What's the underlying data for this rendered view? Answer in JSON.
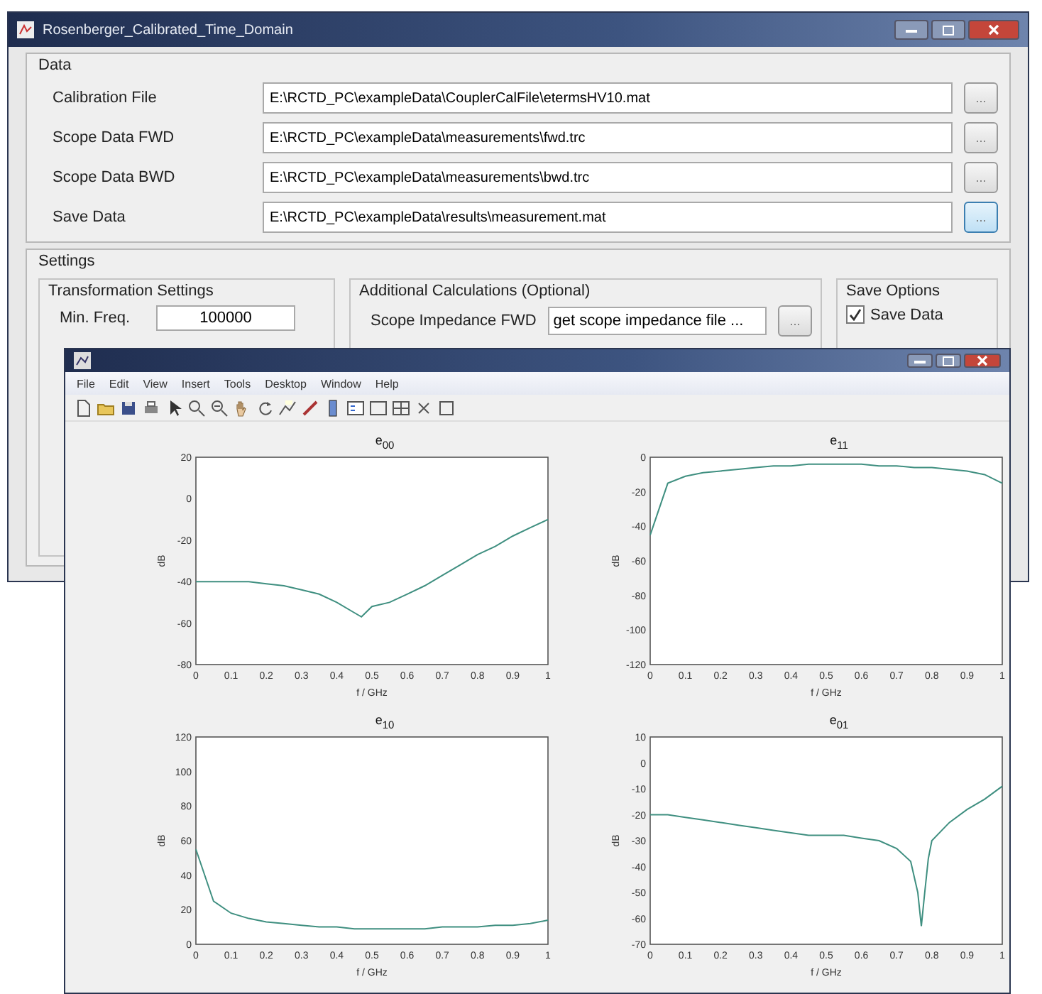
{
  "back_window": {
    "title": "Rosenberger_Calibrated_Time_Domain",
    "data_group": {
      "label": "Data",
      "rows": [
        {
          "label": "Calibration File",
          "value": "E:\\RCTD_PC\\exampleData\\CouplerCalFile\\etermsHV10.mat",
          "button": "...",
          "focused": false
        },
        {
          "label": "Scope Data FWD",
          "value": "E:\\RCTD_PC\\exampleData\\measurements\\fwd.trc",
          "button": "...",
          "focused": false
        },
        {
          "label": "Scope Data BWD",
          "value": "E:\\RCTD_PC\\exampleData\\measurements\\bwd.trc",
          "button": "...",
          "focused": false
        },
        {
          "label": "Save Data",
          "value": "E:\\RCTD_PC\\exampleData\\results\\measurement.mat",
          "button": "...",
          "focused": true
        }
      ]
    },
    "settings_group": {
      "label": "Settings",
      "transformation": {
        "label": "Transformation Settings",
        "field_label": "Min. Freq.",
        "value": "100000"
      },
      "additional": {
        "label": "Additional Calculations (Optional)",
        "field_label": "Scope Impedance FWD",
        "value": "get scope impedance file ...",
        "button": "..."
      },
      "save_options": {
        "label": "Save Options",
        "checkbox": {
          "label": "Save Data",
          "checked": true
        }
      }
    }
  },
  "figure_window": {
    "menu": [
      "File",
      "Edit",
      "View",
      "Insert",
      "Tools",
      "Desktop",
      "Window",
      "Help"
    ],
    "plots": [
      {
        "title": "e$_{00}$",
        "chart_data": {
          "type": "line",
          "xlabel": "f / GHz",
          "ylabel": "dB",
          "xlim": [
            0,
            1
          ],
          "ylim": [
            -80,
            20
          ],
          "xticks": [
            0,
            0.1,
            0.2,
            0.3,
            0.4,
            0.5,
            0.6,
            0.7,
            0.8,
            0.9,
            1
          ],
          "yticks": [
            20,
            0,
            -20,
            -40,
            -60,
            -80
          ],
          "x": [
            0,
            0.05,
            0.1,
            0.15,
            0.2,
            0.25,
            0.3,
            0.35,
            0.4,
            0.45,
            0.47,
            0.5,
            0.55,
            0.6,
            0.65,
            0.7,
            0.75,
            0.8,
            0.85,
            0.9,
            0.95,
            1
          ],
          "series": [
            {
              "color": "#3f8f80",
              "values": [
                -40,
                -40,
                -40,
                -40,
                -41,
                -42,
                -44,
                -46,
                -50,
                -55,
                -57,
                -52,
                -50,
                -46,
                -42,
                -37,
                -32,
                -27,
                -23,
                -18,
                -14,
                -10
              ]
            }
          ]
        }
      },
      {
        "title": "e$_{11}$",
        "chart_data": {
          "type": "line",
          "xlabel": "f / GHz",
          "ylabel": "dB",
          "xlim": [
            0,
            1
          ],
          "ylim": [
            -120,
            0
          ],
          "xticks": [
            0,
            0.1,
            0.2,
            0.3,
            0.4,
            0.5,
            0.6,
            0.7,
            0.8,
            0.9,
            1
          ],
          "yticks": [
            0,
            -20,
            -40,
            -60,
            -80,
            -100,
            -120
          ],
          "x": [
            0,
            0.05,
            0.1,
            0.15,
            0.2,
            0.25,
            0.3,
            0.35,
            0.4,
            0.45,
            0.5,
            0.55,
            0.6,
            0.65,
            0.7,
            0.75,
            0.8,
            0.85,
            0.9,
            0.95,
            1
          ],
          "series": [
            {
              "color": "#3f8f80",
              "values": [
                -45,
                -15,
                -11,
                -9,
                -8,
                -7,
                -6,
                -5,
                -5,
                -4,
                -4,
                -4,
                -4,
                -5,
                -5,
                -6,
                -6,
                -7,
                -8,
                -10,
                -15
              ]
            }
          ]
        }
      },
      {
        "title": "e$_{10}$",
        "chart_data": {
          "type": "line",
          "xlabel": "f / GHz",
          "ylabel": "dB",
          "xlim": [
            0,
            1
          ],
          "ylim": [
            0,
            120
          ],
          "xticks": [
            0,
            0.1,
            0.2,
            0.3,
            0.4,
            0.5,
            0.6,
            0.7,
            0.8,
            0.9,
            1
          ],
          "yticks": [
            120,
            100,
            80,
            60,
            40,
            20,
            0
          ],
          "x": [
            0,
            0.05,
            0.1,
            0.15,
            0.2,
            0.25,
            0.3,
            0.35,
            0.4,
            0.45,
            0.5,
            0.55,
            0.6,
            0.65,
            0.7,
            0.75,
            0.8,
            0.85,
            0.9,
            0.95,
            1
          ],
          "series": [
            {
              "color": "#3f8f80",
              "values": [
                55,
                25,
                18,
                15,
                13,
                12,
                11,
                10,
                10,
                9,
                9,
                9,
                9,
                9,
                10,
                10,
                10,
                11,
                11,
                12,
                14
              ]
            }
          ]
        }
      },
      {
        "title": "e$_{01}$",
        "chart_data": {
          "type": "line",
          "xlabel": "f / GHz",
          "ylabel": "dB",
          "xlim": [
            0,
            1
          ],
          "ylim": [
            -70,
            10
          ],
          "xticks": [
            0,
            0.1,
            0.2,
            0.3,
            0.4,
            0.5,
            0.6,
            0.7,
            0.8,
            0.9,
            1
          ],
          "yticks": [
            10,
            0,
            -10,
            -20,
            -30,
            -40,
            -50,
            -60,
            -70
          ],
          "x": [
            0,
            0.05,
            0.1,
            0.15,
            0.2,
            0.25,
            0.3,
            0.35,
            0.4,
            0.45,
            0.5,
            0.55,
            0.6,
            0.65,
            0.7,
            0.74,
            0.76,
            0.77,
            0.78,
            0.79,
            0.8,
            0.85,
            0.9,
            0.95,
            1
          ],
          "series": [
            {
              "color": "#3f8f80",
              "values": [
                -20,
                -20,
                -21,
                -22,
                -23,
                -24,
                -25,
                -26,
                -27,
                -28,
                -28,
                -28,
                -29,
                -30,
                -33,
                -38,
                -50,
                -63,
                -50,
                -37,
                -30,
                -23,
                -18,
                -14,
                -9
              ]
            }
          ]
        }
      }
    ]
  }
}
